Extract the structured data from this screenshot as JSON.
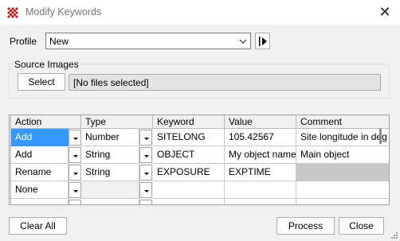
{
  "window": {
    "title": "Modify Keywords",
    "close_glyph": "✕"
  },
  "profile": {
    "label": "Profile",
    "value": "New"
  },
  "source_images": {
    "group_label": "Source Images",
    "select_label": "Select",
    "files_text": "[No files selected]"
  },
  "grid": {
    "headers": [
      "Action",
      "Type",
      "Keyword",
      "Value",
      "Comment"
    ],
    "rows": [
      {
        "action": "Add",
        "type": "Number",
        "keyword": "SITELONG",
        "value": "105.42567",
        "comment": "Site longitude in deg"
      },
      {
        "action": "Add",
        "type": "String",
        "keyword": "OBJECT",
        "value": "My object name",
        "comment": "Main object"
      },
      {
        "action": "Rename",
        "type": "String",
        "keyword": "EXPOSURE",
        "value": "EXPTIME",
        "comment": ""
      },
      {
        "action": "None",
        "type": "",
        "keyword": "",
        "value": "",
        "comment": ""
      }
    ]
  },
  "buttons": {
    "clear_all": "Clear All",
    "process": "Process",
    "close": "Close"
  },
  "colors": {
    "selection": "#3399ff",
    "disabled_cell": "#c8c8c8"
  }
}
